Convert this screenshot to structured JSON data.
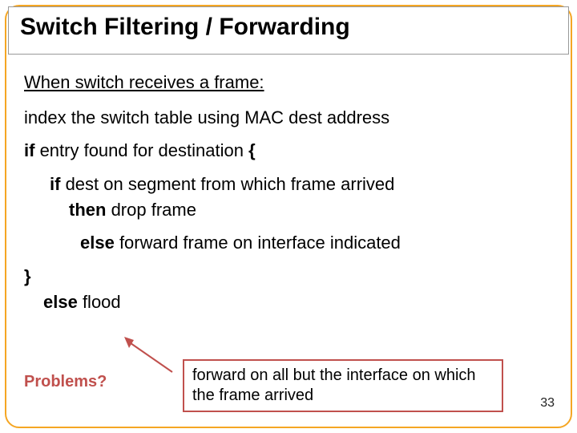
{
  "title": "Switch Filtering / Forwarding",
  "subhead": "When switch receives a frame:",
  "line_index": "index the switch table using MAC dest address",
  "kw_if1": "if",
  "txt_if1": " entry found for destination ",
  "brace_open": "{",
  "kw_if2": "if",
  "txt_if2": " dest on segment from which frame arrived",
  "kw_then": "then",
  "txt_then": " drop frame",
  "kw_else1": "else",
  "txt_else1": " forward frame on interface indicated",
  "brace_close": "}",
  "kw_else2": "else",
  "txt_else2": " flood",
  "problems": "Problems?",
  "callout": "forward on all but the interface on which the frame arrived",
  "page_num": "33"
}
